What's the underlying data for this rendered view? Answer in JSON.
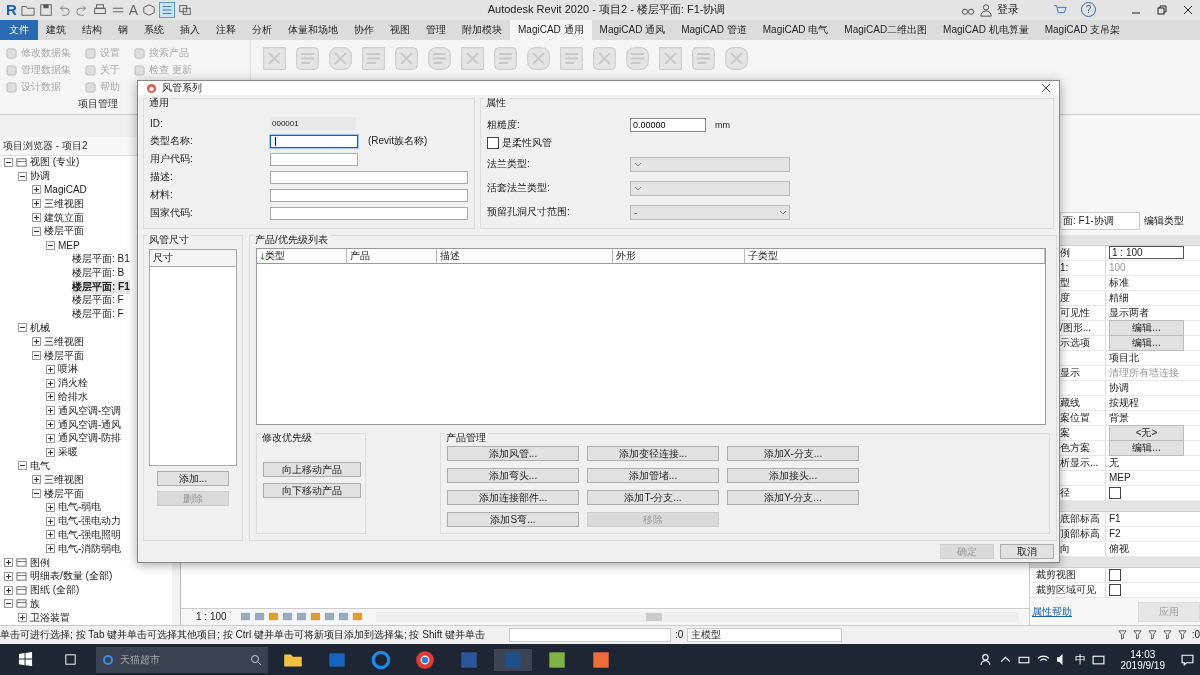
{
  "titlebar": {
    "logo": "R",
    "text_tool": "A",
    "title": "Autodesk Revit 2020 - 项目2 - 楼层平面: F1-协调",
    "login": "登录",
    "help": "?"
  },
  "ribbon": {
    "file_tab": "文件",
    "tabs": [
      {
        "label": "建筑",
        "selected": false
      },
      {
        "label": "结构",
        "selected": false
      },
      {
        "label": "钢",
        "selected": false
      },
      {
        "label": "系统",
        "selected": false
      },
      {
        "label": "插入",
        "selected": false
      },
      {
        "label": "注释",
        "selected": false
      },
      {
        "label": "分析",
        "selected": false
      },
      {
        "label": "体量和场地",
        "selected": false
      },
      {
        "label": "协作",
        "selected": false
      },
      {
        "label": "视图",
        "selected": false
      },
      {
        "label": "管理",
        "selected": false
      },
      {
        "label": "附加模块",
        "selected": false
      },
      {
        "label": "MagiCAD 通用",
        "selected": true
      },
      {
        "label": "MagiCAD 通风",
        "selected": false
      },
      {
        "label": "MagiCAD 管道",
        "selected": false
      },
      {
        "label": "MagiCAD 电气",
        "selected": false
      },
      {
        "label": "MagiCAD二维出图",
        "selected": false
      },
      {
        "label": "MagiCAD 机电算量",
        "selected": false
      },
      {
        "label": "MagiCAD 支吊架",
        "selected": false
      }
    ],
    "panel": {
      "title": "项目管理",
      "items": [
        {
          "label": "修改数据集",
          "disabled": true
        },
        {
          "label": "管理数据集",
          "disabled": true
        },
        {
          "label": "设计数据",
          "disabled": true
        },
        {
          "label": "设置",
          "disabled": true
        },
        {
          "label": "关于",
          "disabled": true
        },
        {
          "label": "帮助",
          "disabled": true
        },
        {
          "label": "搜索产品",
          "disabled": true
        },
        {
          "label": "检查 更新",
          "disabled": true
        }
      ]
    }
  },
  "browser": {
    "title": "项目浏览器 - 项目2",
    "tree": [
      {
        "label": "视图 (专业)",
        "expanded": true,
        "children": [
          {
            "label": "协调",
            "expanded": true,
            "children": [
              {
                "label": "MagiCAD",
                "expanded": false
              },
              {
                "label": "三维视图",
                "expanded": false
              },
              {
                "label": "建筑立面",
                "expanded": false
              },
              {
                "label": "楼层平面",
                "expanded": true,
                "children": [
                  {
                    "label": "MEP",
                    "expanded": true,
                    "children": [
                      {
                        "label": "楼层平面: B1",
                        "selected": false
                      },
                      {
                        "label": "楼层平面: B",
                        "selected": false
                      },
                      {
                        "label": "楼层平面: F1",
                        "selected": true
                      },
                      {
                        "label": "楼层平面: F",
                        "selected": false
                      },
                      {
                        "label": "楼层平面: F",
                        "selected": false
                      }
                    ]
                  }
                ]
              }
            ]
          },
          {
            "label": "机械",
            "expanded": true,
            "children": [
              {
                "label": "三维视图",
                "expanded": false
              },
              {
                "label": "楼层平面",
                "expanded": true,
                "children": [
                  {
                    "label": "喷淋",
                    "expanded": false
                  },
                  {
                    "label": "消火栓",
                    "expanded": false
                  },
                  {
                    "label": "给排水",
                    "expanded": false
                  },
                  {
                    "label": "通风空调-空调",
                    "expanded": false
                  },
                  {
                    "label": "通风空调-通风",
                    "expanded": false
                  },
                  {
                    "label": "通风空调-防排",
                    "expanded": false
                  },
                  {
                    "label": "采暖",
                    "expanded": false
                  }
                ]
              }
            ]
          },
          {
            "label": "电气",
            "expanded": true,
            "children": [
              {
                "label": "三维视图",
                "expanded": false
              },
              {
                "label": "楼层平面",
                "expanded": true,
                "children": [
                  {
                    "label": "电气-弱电",
                    "expanded": false
                  },
                  {
                    "label": "电气-强电动力",
                    "expanded": false
                  },
                  {
                    "label": "电气-强电照明",
                    "expanded": false
                  },
                  {
                    "label": "电气-消防弱电",
                    "expanded": false
                  }
                ]
              }
            ]
          }
        ]
      },
      {
        "label": "图例",
        "expanded": false
      },
      {
        "label": "明细表/数量 (全部)",
        "expanded": false
      },
      {
        "label": "图纸 (全部)",
        "expanded": false
      },
      {
        "label": "族",
        "expanded": true,
        "children": [
          {
            "label": "卫浴装置",
            "expanded": false
          }
        ]
      }
    ]
  },
  "view_bar": {
    "scale": "1 : 100"
  },
  "properties": {
    "type_selector": "面: F1-协调",
    "edit_type": "编辑类型",
    "sections": [
      {
        "rows": [
          {
            "label": "例",
            "value": "1 : 100",
            "kind": "field"
          },
          {
            "label": "1:",
            "value": "100",
            "kind": "muted"
          },
          {
            "label": "型",
            "value": "标准",
            "kind": "text"
          },
          {
            "label": "度",
            "value": "精细",
            "kind": "text"
          },
          {
            "label": "可见性",
            "value": "显示两者",
            "kind": "text"
          },
          {
            "label": "/图形...",
            "value": "编辑...",
            "kind": "button"
          },
          {
            "label": "示选项",
            "value": "编辑...",
            "kind": "button"
          },
          {
            "value": "项目北",
            "kind": "text"
          },
          {
            "label": "显示",
            "value": "清理所有墙连接",
            "kind": "muted"
          },
          {
            "value": "协调",
            "kind": "text"
          },
          {
            "label": "藏线",
            "value": "按规程",
            "kind": "text"
          },
          {
            "label": "案位置",
            "value": "背景",
            "kind": "text"
          },
          {
            "label": "案",
            "value": "<无>",
            "kind": "button"
          },
          {
            "label": "色方案",
            "value": "编辑...",
            "kind": "button"
          },
          {
            "label": "析显示...",
            "value": "无",
            "kind": "text"
          },
          {
            "value": "MEP",
            "kind": "text"
          },
          {
            "label": "径",
            "checked": false,
            "kind": "check"
          }
        ]
      },
      {
        "rows": [
          {
            "label": "底部标高",
            "value": "F1",
            "kind": "text"
          },
          {
            "label": "顶部标高",
            "value": "F2",
            "kind": "text"
          },
          {
            "label": "向",
            "value": "俯视",
            "kind": "text"
          }
        ]
      },
      {
        "rows": [
          {
            "label": "裁剪视图",
            "checked": false,
            "kind": "check"
          },
          {
            "label": "裁剪区域可见",
            "checked": false,
            "kind": "check"
          }
        ]
      }
    ],
    "help_link": "属性帮助",
    "apply": "应用"
  },
  "dialog": {
    "title": "风管系列",
    "general": {
      "title": "通用",
      "fields": [
        {
          "label": "ID:",
          "value": "000001",
          "kind": "readonly",
          "focused": false
        },
        {
          "label": "类型名称:",
          "kind": "short",
          "focused": true,
          "note": "(Revit族名称)"
        },
        {
          "label": "用户代码:",
          "kind": "short",
          "focused": false
        },
        {
          "label": "描述:",
          "kind": "long",
          "focused": false
        },
        {
          "label": "材料:",
          "kind": "long",
          "focused": false
        },
        {
          "label": "国家代码:",
          "kind": "long",
          "focused": false
        }
      ]
    },
    "attributes": {
      "title": "属性",
      "roughness": {
        "label": "粗糙度:",
        "value": "0.00000",
        "unit": "mm"
      },
      "flexible": {
        "label": "是柔性风管",
        "checked": false
      },
      "dropdowns": [
        {
          "label": "法兰类型:",
          "disabled": true
        },
        {
          "label": "活套法兰类型:",
          "disabled": true
        },
        {
          "label": "预留孔洞尺寸范围:",
          "value": "-",
          "disabled": true
        }
      ]
    },
    "sizes": {
      "title": "风管尺寸",
      "column": "尺寸",
      "buttons": [
        {
          "label": "添加...",
          "disabled": false
        },
        {
          "label": "删除",
          "disabled": true
        }
      ]
    },
    "products": {
      "title": "产品/优先级列表",
      "columns": [
        {
          "label": "类型",
          "sorted": true
        },
        {
          "label": "产品",
          "sorted": false
        },
        {
          "label": "描述",
          "sorted": false
        },
        {
          "label": "外形",
          "sorted": false
        },
        {
          "label": "子类型",
          "sorted": false
        }
      ],
      "priority": {
        "title": "修改优先级",
        "buttons": [
          {
            "label": "向上移动产品",
            "disabled": false
          },
          {
            "label": "向下移动产品",
            "disabled": false
          }
        ]
      },
      "manage": {
        "title": "产品管理",
        "buttons": [
          {
            "label": "添加风管...",
            "disabled": false
          },
          {
            "label": "添加变径连接...",
            "disabled": false
          },
          {
            "label": "添加X-分支...",
            "disabled": false
          },
          {
            "label": "添加弯头...",
            "disabled": false
          },
          {
            "label": "添加管堵...",
            "disabled": false
          },
          {
            "label": "添加接头...",
            "disabled": false
          },
          {
            "label": "添加连接部件...",
            "disabled": false
          },
          {
            "label": "添加T-分支...",
            "disabled": false
          },
          {
            "label": "添加Y-分支...",
            "disabled": false
          },
          {
            "label": "添加S弯...",
            "disabled": false
          },
          {
            "label": "移除",
            "disabled": true
          }
        ]
      }
    },
    "footer": [
      {
        "label": "确定",
        "disabled": true
      },
      {
        "label": "取消",
        "disabled": false
      }
    ]
  },
  "status_bar": {
    "hint": "单击可进行选择; 按 Tab 键并单击可选择其他项目; 按 Ctrl 键并单击可将新项目添加到选择集; 按 Shift 键并单击",
    "count": ":0",
    "model": "主模型",
    "filter_count": ":0"
  },
  "taskbar": {
    "search": {
      "placeholder": "天猫超市"
    },
    "ime": "中",
    "time": "14:03",
    "date": "2019/9/19"
  }
}
